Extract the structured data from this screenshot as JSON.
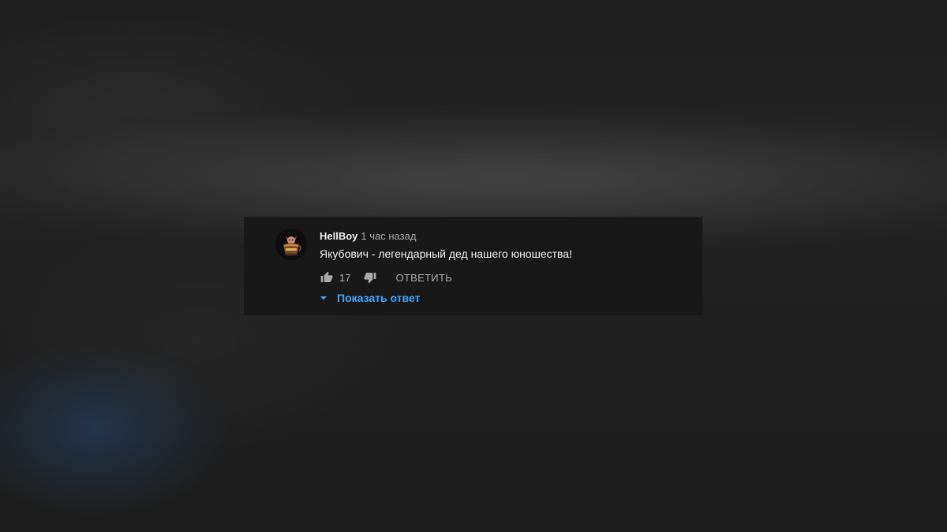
{
  "comment": {
    "author": "HellBoy",
    "timestamp": "1 час назад",
    "text": "Якубович - легендарный дед нашего юношества!",
    "like_count": "17",
    "reply_label": "ОТВЕТИТЬ",
    "show_replies_label": "Показать ответ"
  },
  "icons": {
    "like": "thumb-up-icon",
    "dislike": "thumb-down-icon",
    "expand": "caret-down-icon",
    "avatar": "avatar-image"
  },
  "colors": {
    "card_background": "#181818",
    "author_text": "#f1f1f1",
    "secondary_text": "#aaaaaa",
    "link_blue": "#3ea6ff"
  }
}
